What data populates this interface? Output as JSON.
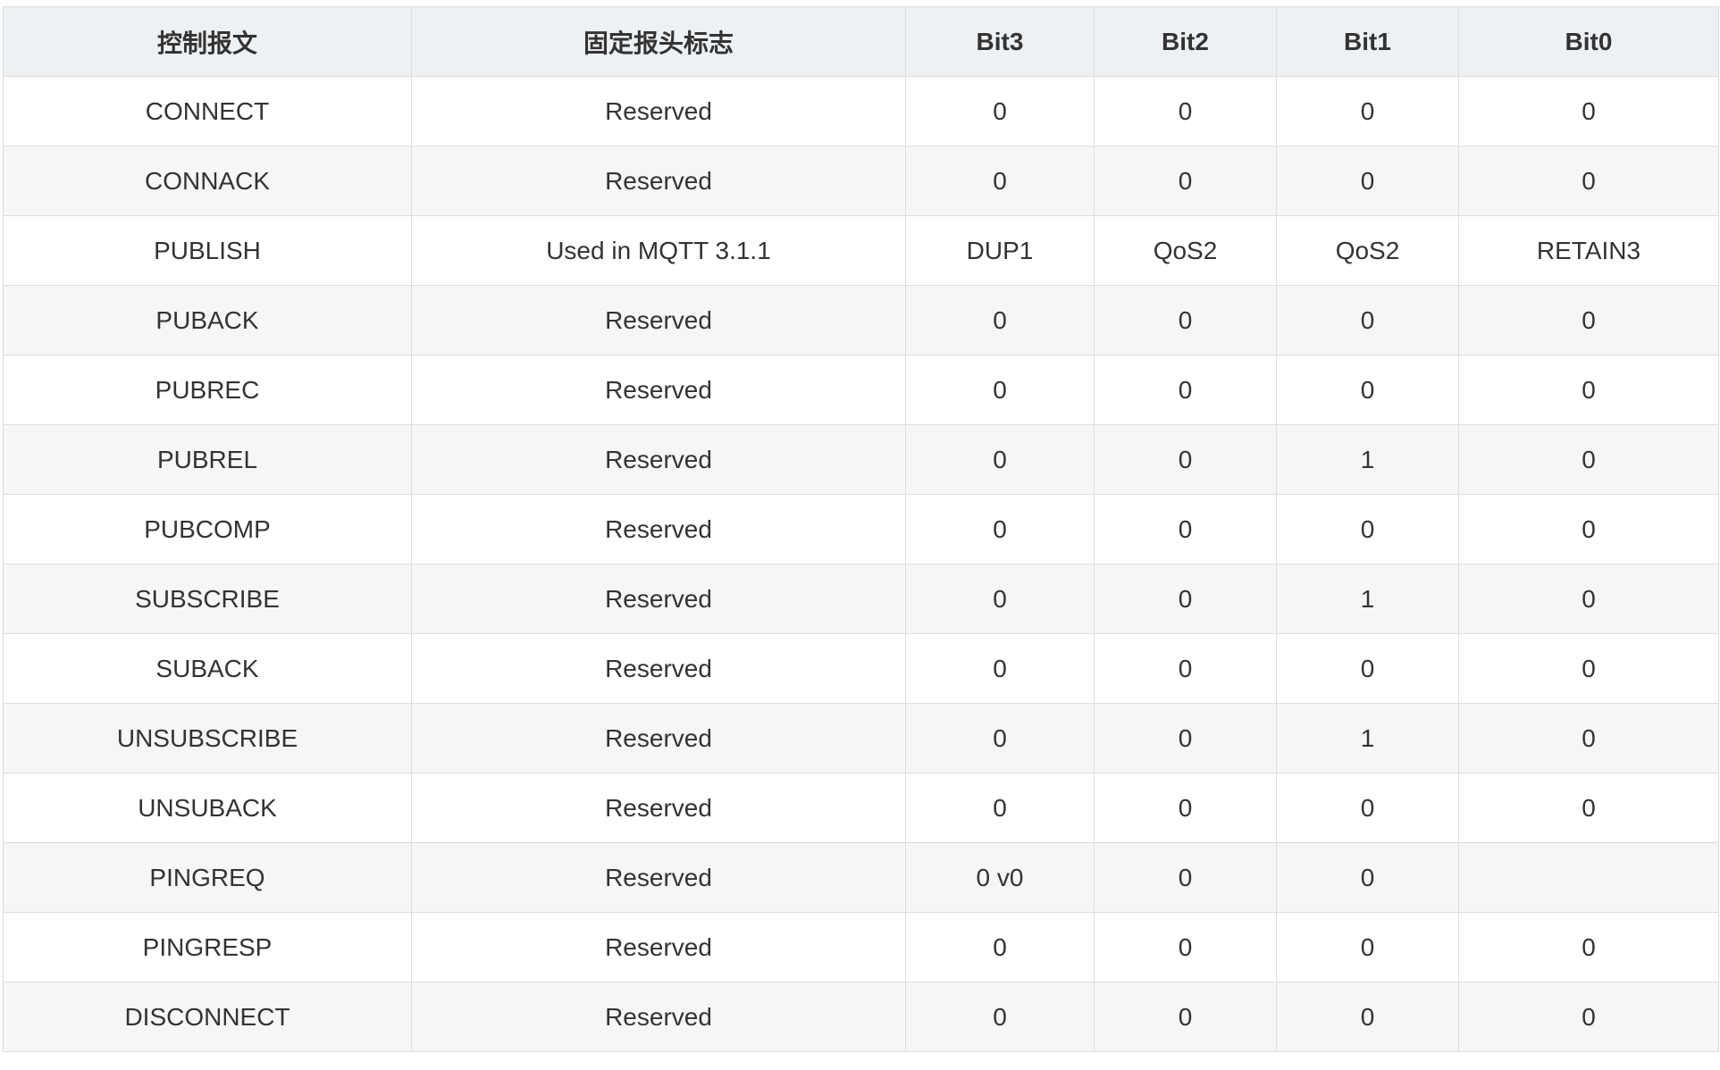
{
  "table": {
    "headers": [
      "控制报文",
      "固定报头标志",
      "Bit3",
      "Bit2",
      "Bit1",
      "Bit0"
    ],
    "rows": [
      [
        "CONNECT",
        "Reserved",
        "0",
        "0",
        "0",
        "0"
      ],
      [
        "CONNACK",
        "Reserved",
        "0",
        "0",
        "0",
        "0"
      ],
      [
        "PUBLISH",
        "Used in MQTT 3.1.1",
        "DUP1",
        "QoS2",
        "QoS2",
        "RETAIN3"
      ],
      [
        "PUBACK",
        "Reserved",
        "0",
        "0",
        "0",
        "0"
      ],
      [
        "PUBREC",
        "Reserved",
        "0",
        "0",
        "0",
        "0"
      ],
      [
        "PUBREL",
        "Reserved",
        "0",
        "0",
        "1",
        "0"
      ],
      [
        "PUBCOMP",
        "Reserved",
        "0",
        "0",
        "0",
        "0"
      ],
      [
        "SUBSCRIBE",
        "Reserved",
        "0",
        "0",
        "1",
        "0"
      ],
      [
        "SUBACK",
        "Reserved",
        "0",
        "0",
        "0",
        "0"
      ],
      [
        "UNSUBSCRIBE",
        "Reserved",
        "0",
        "0",
        "1",
        "0"
      ],
      [
        "UNSUBACK",
        "Reserved",
        "0",
        "0",
        "0",
        "0"
      ],
      [
        "PINGREQ",
        "Reserved",
        "0 v0",
        "0",
        "0",
        ""
      ],
      [
        "PINGRESP",
        "Reserved",
        "0",
        "0",
        "0",
        "0"
      ],
      [
        "DISCONNECT",
        "Reserved",
        "0",
        "0",
        "0",
        "0"
      ]
    ]
  }
}
